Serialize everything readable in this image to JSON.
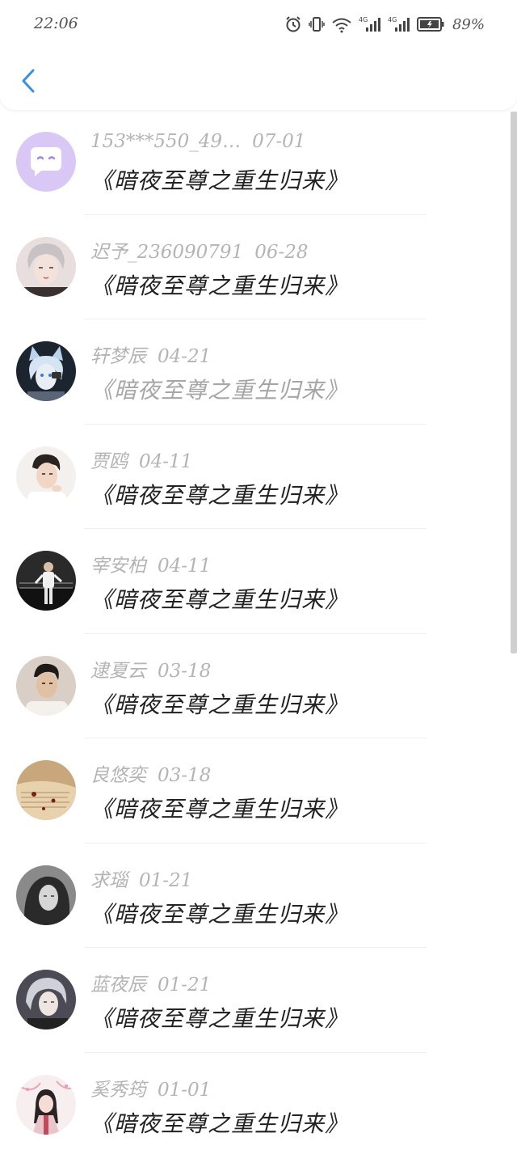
{
  "status_bar": {
    "time": "22:06",
    "battery": "89%",
    "network_1": "4G",
    "network_2": "4G",
    "icons": [
      "alarm-icon",
      "vibrate-icon",
      "wifi-icon",
      "signal-icon",
      "battery-icon"
    ]
  },
  "header": {
    "back_icon": "chevron-left-icon",
    "accent": "#3a8ee6"
  },
  "messages": [
    {
      "name": "153***550_49…",
      "date": "07-01",
      "title": "《暗夜至尊之重生归来》",
      "avatar": "chat-bubble-avatar",
      "dim": false
    },
    {
      "name": "迟予_236090791",
      "date": "06-28",
      "title": "《暗夜至尊之重生归来》",
      "avatar": "anime-boy-avatar",
      "dim": false
    },
    {
      "name": "轩梦辰",
      "date": "04-21",
      "title": "《暗夜至尊之重生归来》",
      "avatar": "cat-ear-avatar",
      "dim": true
    },
    {
      "name": "贾鸥",
      "date": "04-11",
      "title": "《暗夜至尊之重生归来》",
      "avatar": "young-man-avatar",
      "dim": false
    },
    {
      "name": "宰安柏",
      "date": "04-11",
      "title": "《暗夜至尊之重生归来》",
      "avatar": "standing-man-avatar",
      "dim": false
    },
    {
      "name": "逮夏云",
      "date": "03-18",
      "title": "《暗夜至尊之重生归来》",
      "avatar": "boy-portrait-avatar",
      "dim": false
    },
    {
      "name": "良悠奕",
      "date": "03-18",
      "title": "《暗夜至尊之重生归来》",
      "avatar": "book-avatar",
      "dim": false
    },
    {
      "name": "求瑙",
      "date": "01-21",
      "title": "《暗夜至尊之重生归来》",
      "avatar": "bw-girl-avatar",
      "dim": false
    },
    {
      "name": "蓝夜辰",
      "date": "01-21",
      "title": "《暗夜至尊之重生归来》",
      "avatar": "anime-silver-hair-avatar",
      "dim": false
    },
    {
      "name": "奚秀筠",
      "date": "01-01",
      "title": "《暗夜至尊之重生归来》",
      "avatar": "ancient-girl-avatar",
      "dim": false
    }
  ]
}
